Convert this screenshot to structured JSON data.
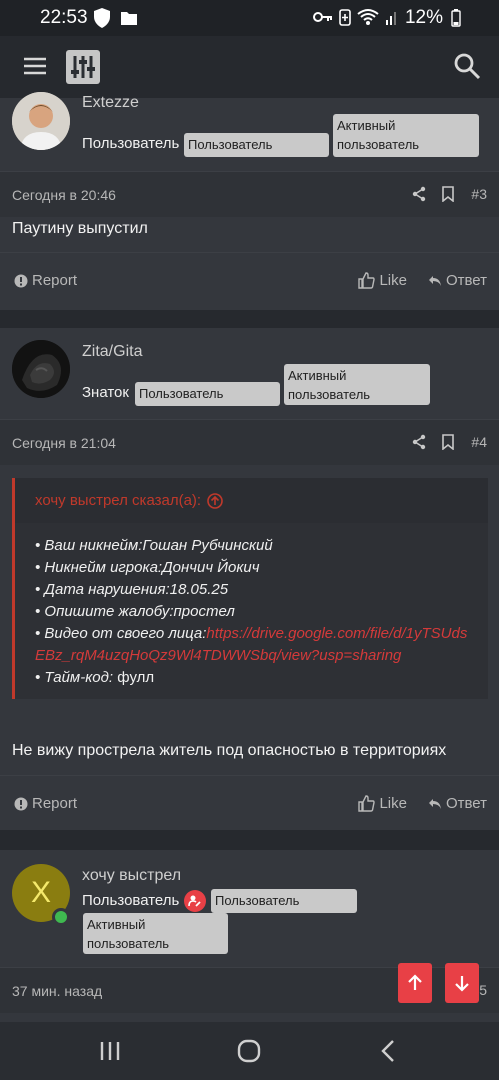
{
  "status_bar": {
    "time": "22:53",
    "battery": "12%",
    "icons_left": [
      "shield-icon",
      "folder-icon"
    ],
    "icons_right": [
      "key-icon",
      "battery-saver-icon",
      "wifi-icon",
      "signal-icon",
      "battery-icon"
    ]
  },
  "app_bar": {
    "menu_icon": "hamburger-icon",
    "logo_icon": "sliders-logo-icon",
    "search_icon": "search-icon"
  },
  "posts": [
    {
      "author": "Extezze",
      "role": "Пользователь",
      "badges": [
        "Пользователь",
        "Активный пользователь"
      ],
      "time": "Сегодня в 20:46",
      "number": "#3",
      "text": "Паутину выпустил",
      "report": "Report",
      "like": "Like",
      "reply": "Ответ"
    },
    {
      "author": "Zita/Gita",
      "role": "Знаток",
      "badges": [
        "Пользователь",
        "Активный пользователь"
      ],
      "time": "Сегодня в 21:04",
      "number": "#4",
      "quote": {
        "header": "хочу выстрел сказал(а):",
        "lines": [
          "• Ваш никнейм:Гошан Рубчинский",
          "• Никнейм игрока:Дончич Йокич",
          "• Дата нарушения:18.05.25",
          "• Опишите жалобу:простел",
          "• Видео от своего лица:"
        ],
        "link": "https://drive.google.com/file/d/1yTSUdsEBz_rqM4uzqHoQz9Wl4TDWWSbq/view?usp=sharing",
        "timecode_label": "• Тайм-код:",
        "timecode_value": "фулл"
      },
      "text": "Не вижу прострела житель под опасностью в территориях",
      "report": "Report",
      "like": "Like",
      "reply": "Ответ"
    },
    {
      "author": "хочу выстрел",
      "avatar_letter": "X",
      "role": "Пользователь",
      "badges": [
        "Пользователь",
        "Активный пользователь"
      ],
      "time": "37 мин. назад",
      "number_partial": "5"
    }
  ],
  "colors": {
    "accent": "#e84046",
    "avatar_x_bg": "#8a7d10",
    "online_dot": "#3fb950"
  }
}
